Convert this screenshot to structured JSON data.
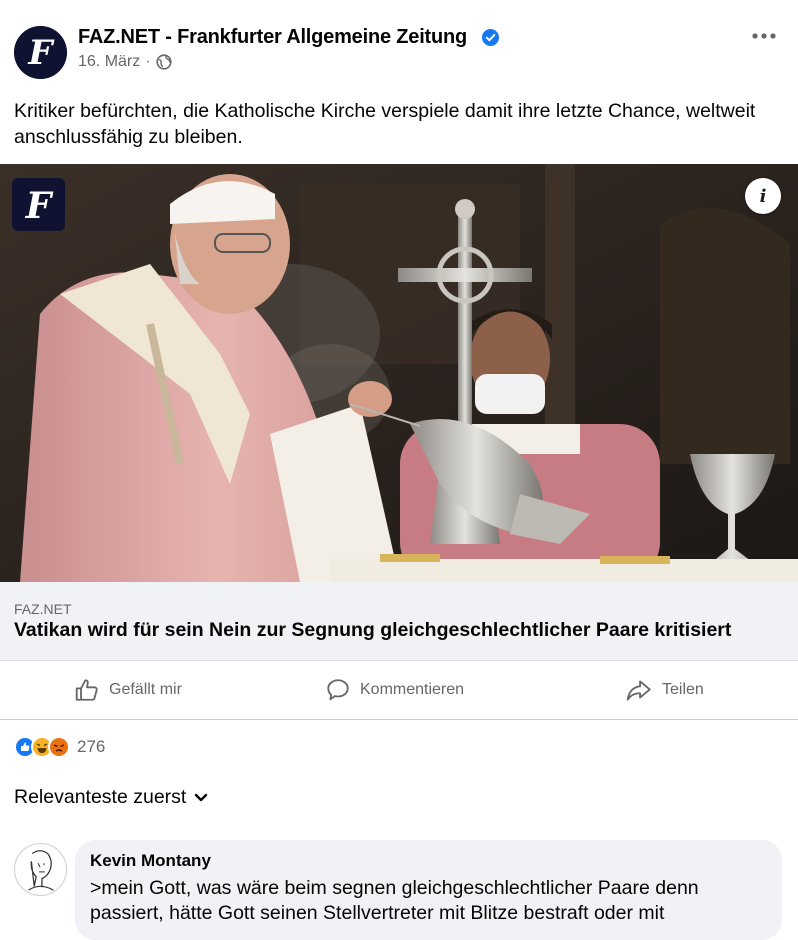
{
  "post": {
    "page_name": "FAZ.NET - Frankfurter Allgemeine Zeitung",
    "date": "16. März",
    "separator": "·",
    "text": "Kritiker befürchten, die Katholische Kirche verspiele damit ihre letzte Chance, weltweit anschlussfähig zu bleiben.",
    "logo_letter": "F"
  },
  "link": {
    "domain": "FAZ.NET",
    "title": "Vatikan wird für sein Nein zur Segnung gleichgeschlechtlicher Paare kritisiert",
    "info_label": "i"
  },
  "actions": {
    "like": "Gefällt mir",
    "comment": "Kommentieren",
    "share": "Teilen"
  },
  "reactions": {
    "count": "276",
    "icons": [
      "like-icon",
      "haha-icon",
      "angry-icon"
    ]
  },
  "comments": {
    "sort_label": "Relevanteste zuerst",
    "items": [
      {
        "author": "Kevin Montany",
        "text": ">mein Gott, was wäre beim segnen gleichgeschlechtlicher Paare denn passiert, hätte Gott seinen Stellvertreter  mit Blitze bestraft oder mit"
      }
    ]
  },
  "colors": {
    "brand_dark": "#0f1230",
    "verified_blue": "#1877f2",
    "muted_text": "#65676b",
    "link_box_bg": "#f0f2f5"
  }
}
